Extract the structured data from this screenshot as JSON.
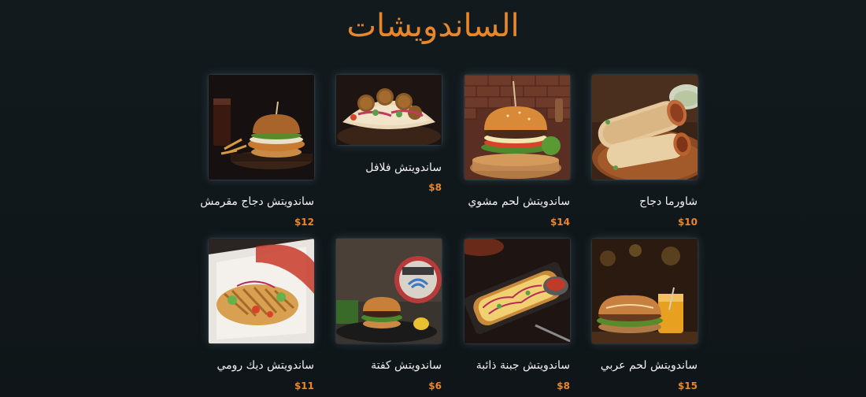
{
  "page": {
    "title": "الساندويشات",
    "accent_color": "#e8862a",
    "background_color": "#101619"
  },
  "items": [
    {
      "name": "شاورما دجاج",
      "price": "$10",
      "image": "chicken-shawarma-photo"
    },
    {
      "name": "ساندويتش لحم مشوي",
      "price": "$14",
      "image": "grilled-meat-burger-photo"
    },
    {
      "name": "ساندويتش فلافل",
      "price": "$8",
      "image": "falafel-pita-photo"
    },
    {
      "name": "ساندويتش دجاج مقرمش",
      "price": "$12",
      "image": "crispy-chicken-burger-photo"
    },
    {
      "name": "ساندويتش لحم عربي",
      "price": "$15",
      "image": "arabic-meat-sandwich-photo"
    },
    {
      "name": "ساندويتش جبنة ذائبة",
      "price": "$8",
      "image": "melted-cheese-sandwich-photo"
    },
    {
      "name": "ساندويتش كفتة",
      "price": "$6",
      "image": "kofta-burger-photo"
    },
    {
      "name": "ساندويتش ديك رومي",
      "price": "$11",
      "image": "turkey-doner-wrap-photo"
    }
  ]
}
